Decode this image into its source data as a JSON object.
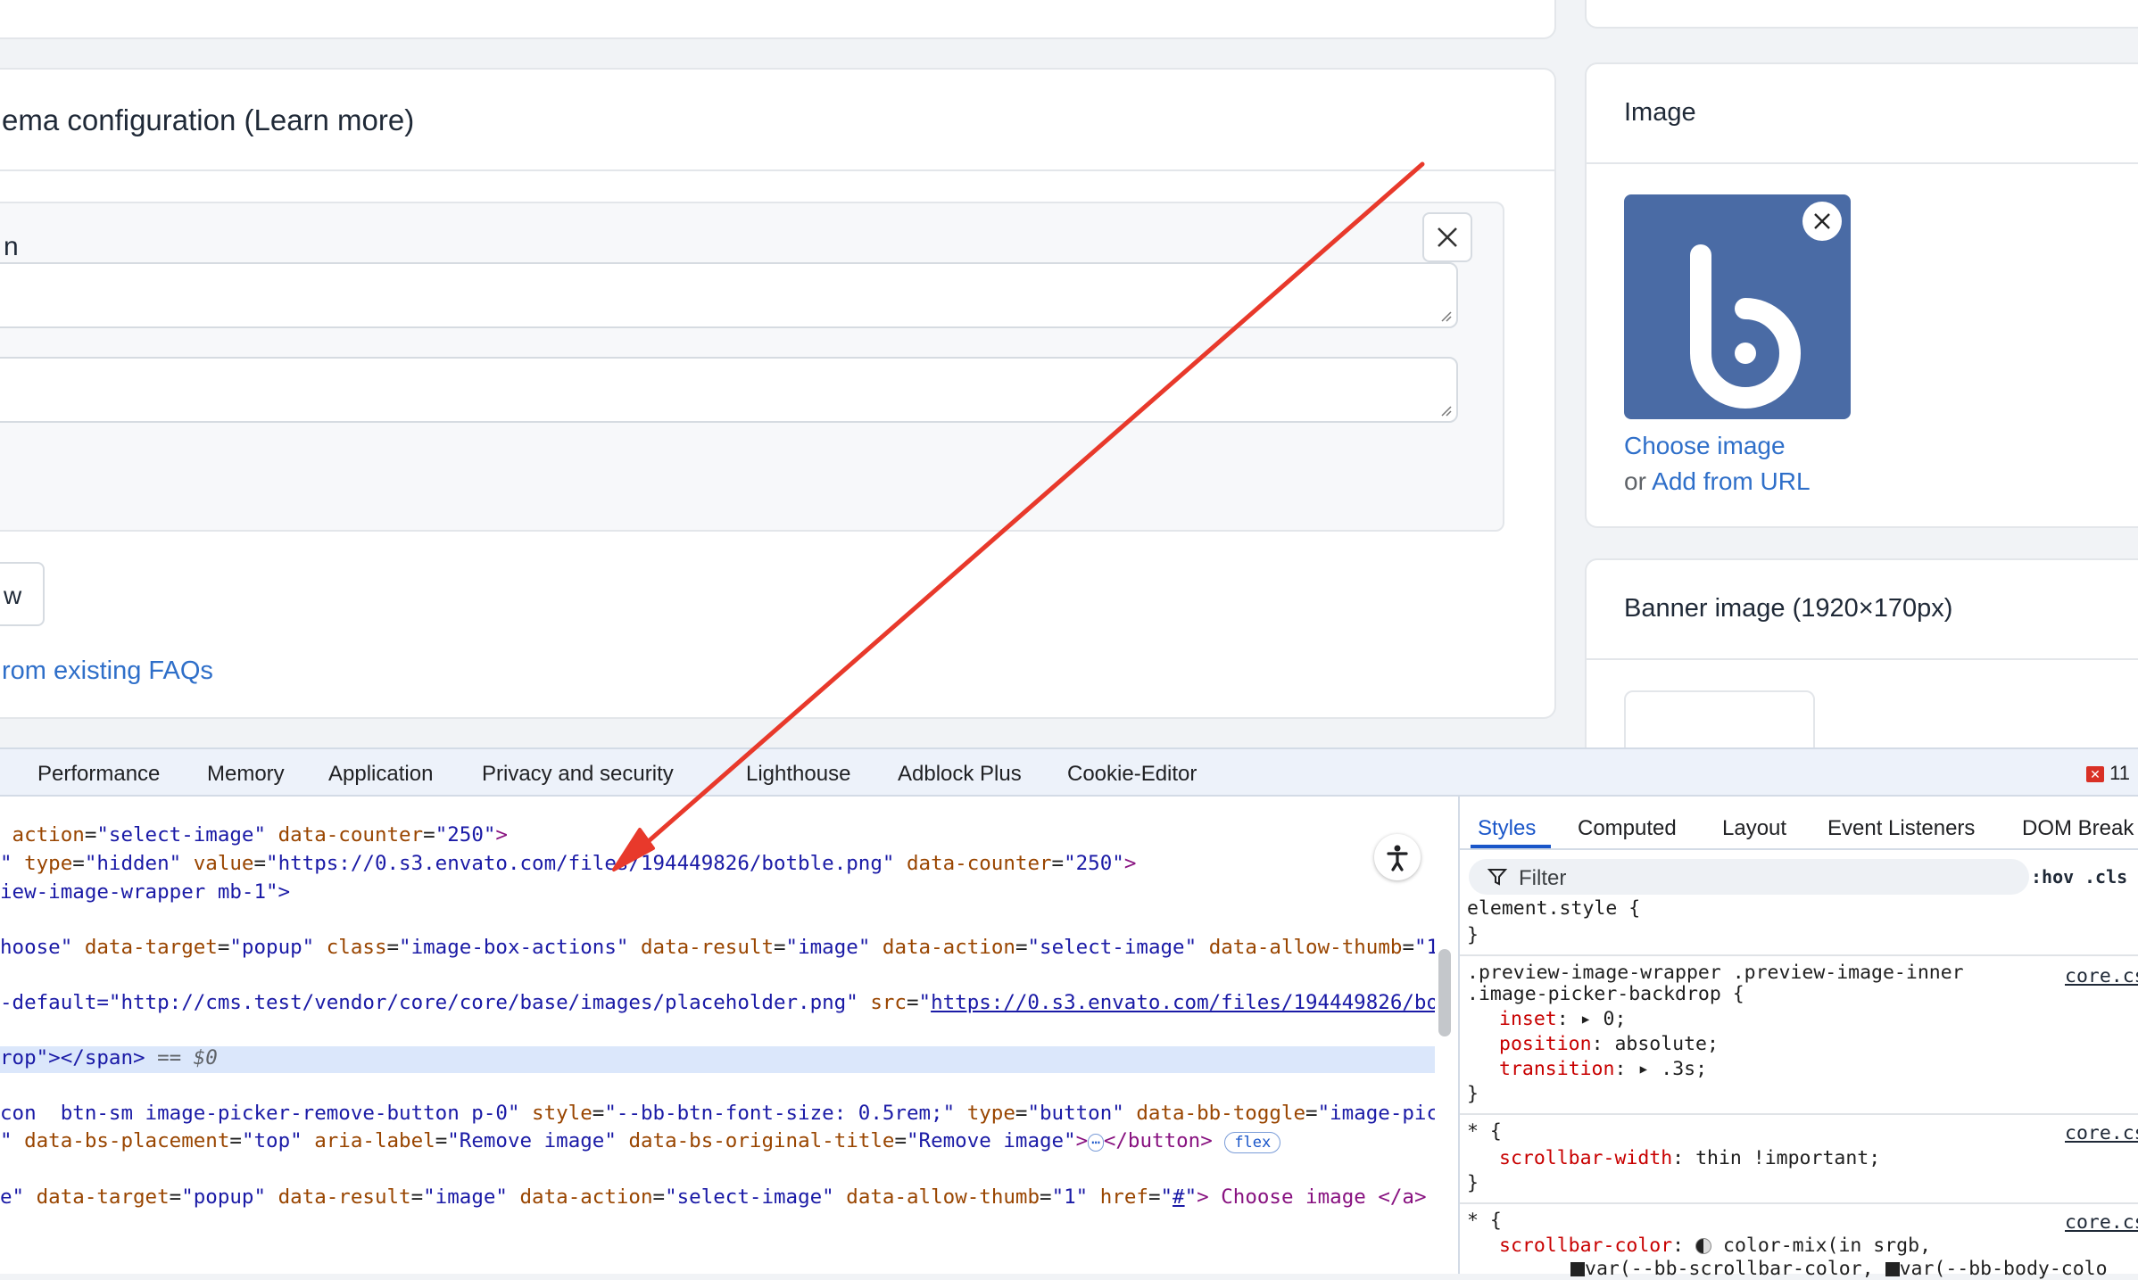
{
  "page": {
    "schema_title": "ema configuration (Learn more)",
    "faq_item_label": "n",
    "add_button_partial": "w",
    "select_faqs_link": "rom existing FAQs"
  },
  "sidebar": {
    "image_card": {
      "title": "Image",
      "choose_image": "Choose image",
      "or_text": "or",
      "add_from_url": "Add from URL"
    },
    "banner_card": {
      "title": "Banner image (1920×170px)"
    }
  },
  "devtools": {
    "tabs": [
      "Performance",
      "Memory",
      "Application",
      "Privacy and security",
      "Lighthouse",
      "Adblock Plus",
      "Cookie-Editor"
    ],
    "error_count": "11",
    "elements": {
      "l1": {
        "a1": "action",
        "v1": "\"select-image\"",
        "a2": "data-counter",
        "v2": "\"250\"",
        "end": ">"
      },
      "l2": {
        "pre": "\"",
        "a1": "type",
        "v1": "\"hidden\"",
        "a2": "value",
        "v2": "\"https://0.s3.envato.com/files/194449826/botble.png\"",
        "a3": "data-counter",
        "v3": "\"250\"",
        "end": ">"
      },
      "l3": {
        "text": "iew-image-wrapper mb-1\">"
      },
      "l4": {
        "text": "hoose\"",
        "a1": "data-target",
        "v1": "\"popup\"",
        "a2": "class",
        "v2": "\"image-box-actions\"",
        "a3": "data-result",
        "v3": "\"image\"",
        "a4": "data-action",
        "v4": "\"select-image\"",
        "a5": "data-allow-thumb",
        "v5": "\"1\""
      },
      "l5": {
        "text": "-default=\"http://cms.test/vendor/core/core/base/images/placeholder.png\"",
        "a1": "src",
        "v1": "https://0.s3.envato.com/files/194449826/botb"
      },
      "l6": {
        "text": "rop\"></span>",
        "eq": " == $0"
      },
      "l7": {
        "text": "con  btn-sm image-picker-remove-button p-0\"",
        "a1": "style",
        "v1": "\"--bb-btn-font-size: 0.5rem;\"",
        "a2": "type",
        "v2": "\"button\"",
        "a3": "data-bb-toggle",
        "v3": "\"image-picke"
      },
      "l8": {
        "pre": "\"",
        "a1": "data-bs-placement",
        "v1": "\"top\"",
        "a2": "aria-label",
        "v2": "\"Remove image\"",
        "a3": "data-bs-original-title",
        "v3": "\"Remove image\"",
        "end": "></button>",
        "badge": "flex",
        "ellipsis": "⋯"
      },
      "l9": {
        "pre": "e\"",
        "a1": "data-target",
        "v1": "\"popup\"",
        "a2": "data-result",
        "v2": "\"image\"",
        "a3": "data-action",
        "v3": "\"select-image\"",
        "a4": "data-allow-thumb",
        "v4": "\"1\"",
        "a5": "href",
        "v5": "#",
        "text": "> Choose image </a>"
      }
    },
    "styles": {
      "tabs": [
        "Styles",
        "Computed",
        "Layout",
        "Event Listeners",
        "DOM Break"
      ],
      "filter_placeholder": "Filter",
      "hov": ":hov",
      "cls": ".cls",
      "element_style": "element.style {",
      "rule1": {
        "selector1": ".preview-image-wrapper .preview-image-inner",
        "selector2": ".image-picker-backdrop {",
        "source": "core.cs",
        "p1": "inset",
        "v1": "0;",
        "p2": "position",
        "v2": "absolute;",
        "p3": "transition",
        "v3": ".3s;"
      },
      "rule2": {
        "selector": "* {",
        "source": "core.cs",
        "p1": "scrollbar-width",
        "v1": "thin !important;"
      },
      "rule3": {
        "selector": "* {",
        "source": "core.cs",
        "p1": "scrollbar-color",
        "v1": "color-mix(in srgb,",
        "cont": "var(--bb-scrollbar-color,",
        "cont2": "var(--bb-body-colo"
      }
    }
  },
  "colors": {
    "annotation_arrow": "#e8392b",
    "logo_bg": "#4a6ba5",
    "link": "#2f6fc9"
  }
}
